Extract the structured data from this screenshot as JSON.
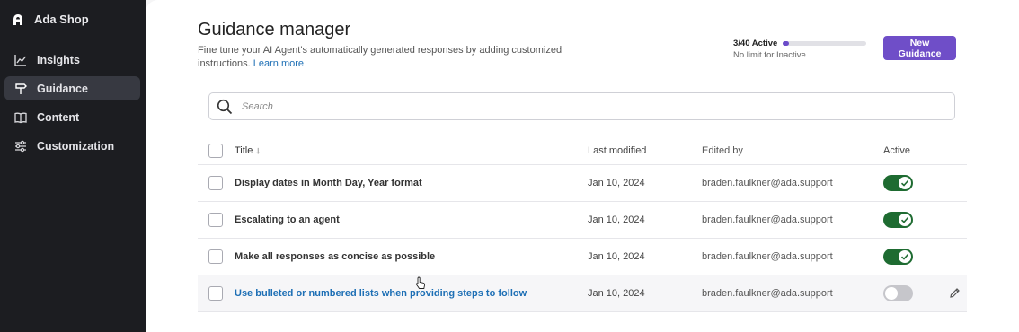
{
  "sidebar": {
    "brand": "Ada Shop",
    "items": [
      {
        "label": "Insights",
        "icon": "chart-line-icon"
      },
      {
        "label": "Guidance",
        "icon": "signpost-icon"
      },
      {
        "label": "Content",
        "icon": "book-icon"
      },
      {
        "label": "Customization",
        "icon": "sliders-icon"
      }
    ],
    "active": "Guidance"
  },
  "header": {
    "title": "Guidance manager",
    "description": "Fine tune your AI Agent's automatically generated responses by adding customized instructions.",
    "learn_more": "Learn more"
  },
  "usage": {
    "label": "3/40 Active",
    "active": 3,
    "limit": 40,
    "sublabel": "No limit for Inactive"
  },
  "actions": {
    "new_guidance": "New Guidance"
  },
  "search": {
    "placeholder": "Search"
  },
  "table": {
    "columns": {
      "title": "Title ↓",
      "modified": "Last modified",
      "editor": "Edited by",
      "active": "Active"
    },
    "rows": [
      {
        "title": "Display dates in Month Day, Year format",
        "modified": "Jan 10, 2024",
        "editor": "braden.faulkner@ada.support",
        "active": true
      },
      {
        "title": "Escalating to an agent",
        "modified": "Jan 10, 2024",
        "editor": "braden.faulkner@ada.support",
        "active": true
      },
      {
        "title": "Make all responses as concise as possible",
        "modified": "Jan 10, 2024",
        "editor": "braden.faulkner@ada.support",
        "active": true
      },
      {
        "title": "Use bulleted or numbered lists when providing steps to follow",
        "modified": "Jan 10, 2024",
        "editor": "braden.faulkner@ada.support",
        "active": false
      }
    ]
  },
  "colors": {
    "accent": "#6f4ec8",
    "toggle_on": "#1e6b31",
    "link": "#1d6fb5",
    "sidebar_bg": "#1c1d21"
  }
}
